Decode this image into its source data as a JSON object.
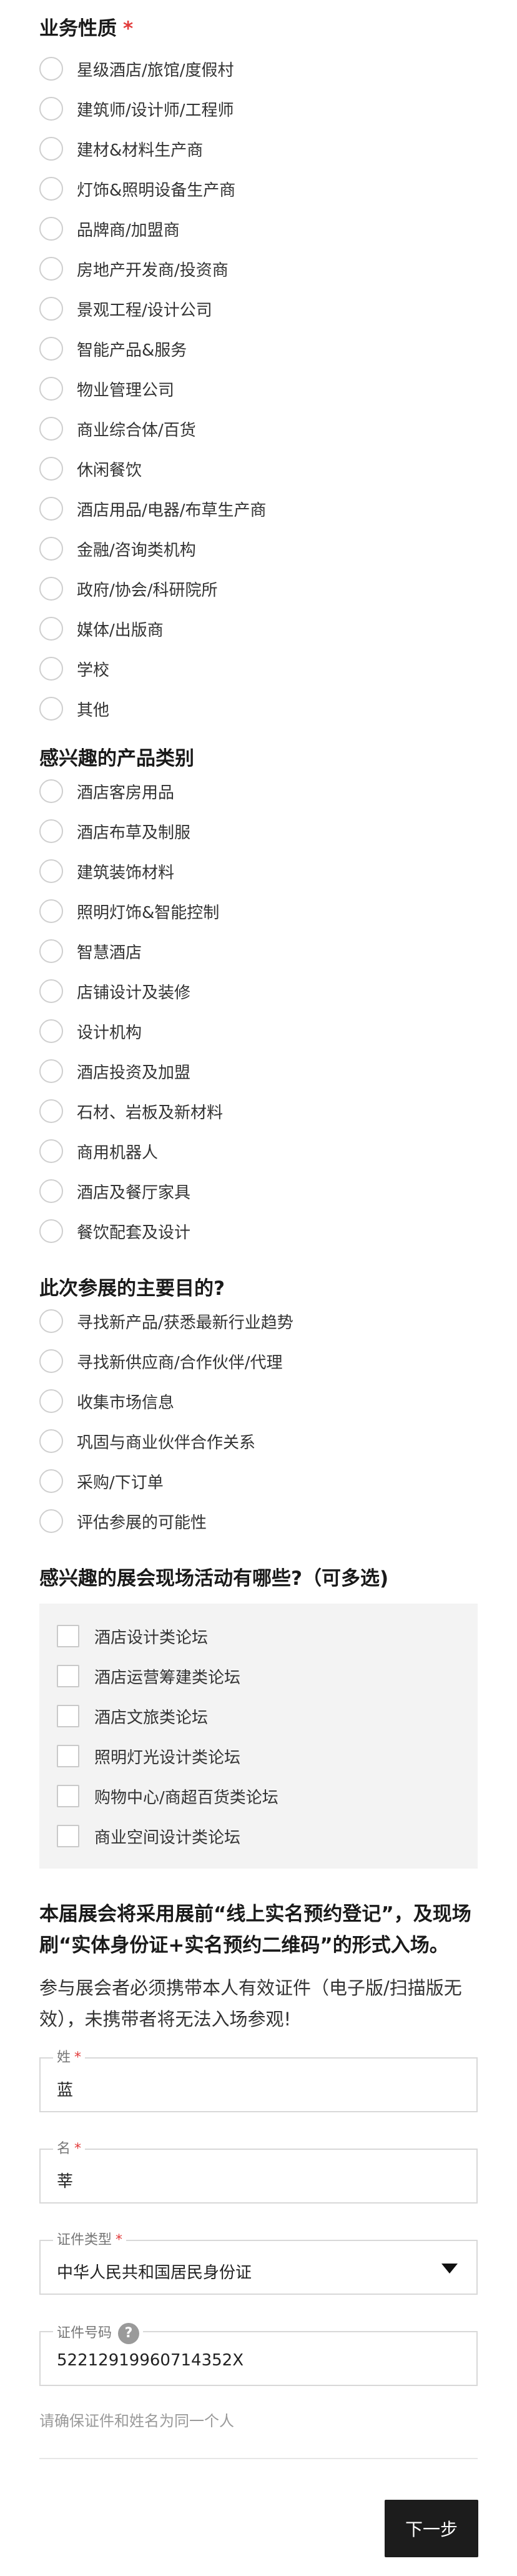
{
  "business": {
    "title": "业务性质",
    "required_mark": "*",
    "options": [
      "星级酒店/旅馆/度假村",
      "建筑师/设计师/工程师",
      "建材&材料生产商",
      "灯饰&照明设备生产商",
      "品牌商/加盟商",
      "房地产开发商/投资商",
      "景观工程/设计公司",
      "智能产品&服务",
      "物业管理公司",
      "商业综合体/百货",
      "休闲餐饮",
      "酒店用品/电器/布草生产商",
      "金融/咨询类机构",
      "政府/协会/科研院所",
      "媒体/出版商",
      "学校",
      "其他"
    ]
  },
  "products": {
    "title": "感兴趣的产品类别",
    "options": [
      "酒店客房用品",
      "酒店布草及制服",
      "建筑装饰材料",
      "照明灯饰&智能控制",
      "智慧酒店",
      "店铺设计及装修",
      "设计机构",
      "酒店投资及加盟",
      "石材、岩板及新材料",
      "商用机器人",
      "酒店及餐厅家具",
      "餐饮配套及设计"
    ]
  },
  "purpose": {
    "title": "此次参展的主要目的?",
    "options": [
      "寻找新产品/获悉最新行业趋势",
      "寻找新供应商/合作伙伴/代理",
      "收集市场信息",
      "巩固与商业伙伴合作关系",
      "采购/下订单",
      "评估参展的可能性"
    ]
  },
  "activities": {
    "title": "感兴趣的展会现场活动有哪些?（可多选)",
    "options": [
      "酒店设计类论坛",
      "酒店运营筹建类论坛",
      "酒店文旅类论坛",
      "照明灯光设计类论坛",
      "购物中心/商超百货类论坛",
      "商业空间设计类论坛"
    ]
  },
  "notice": {
    "bold": "本届展会将采用展前“线上实名预约登记”，及现场刷“实体身份证+实名预约二维码”的形式入场。",
    "text": "参与展会者必须携带本人有效证件（电子版/扫描版无效），未携带者将无法入场参观!"
  },
  "form": {
    "surname": {
      "label": "姓",
      "required": "*",
      "value": "蓝"
    },
    "given_name": {
      "label": "名",
      "required": "*",
      "value": "莘"
    },
    "id_type": {
      "label": "证件类型",
      "required": "*",
      "value": "中华人民共和国居民身份证"
    },
    "id_number": {
      "label": "证件号码",
      "help": "?",
      "value": "52212919960714352X"
    },
    "hint": "请确保证件和姓名为同一个人"
  },
  "footer": {
    "next_label": "下一步"
  }
}
